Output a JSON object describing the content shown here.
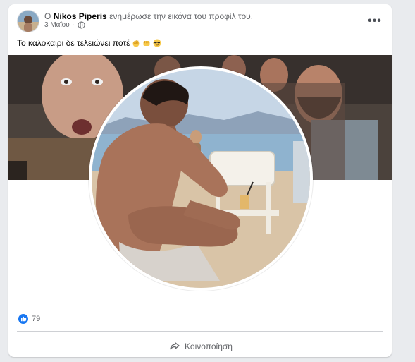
{
  "post": {
    "title_prefix": "Ο",
    "author": "Nikos Piperis",
    "title_suffix": "ενημέρωσε την εικόνα του προφίλ του.",
    "date": "3 Μαΐου",
    "date_separator": "·",
    "text": "Το καλοκαίρι δε τελειώνει ποτέ",
    "emojis": [
      "ok-hand-emoji",
      "fist-emoji",
      "sunglasses-emoji"
    ],
    "more_label": "•••"
  },
  "reactions": {
    "icon": "like-icon",
    "count": "79"
  },
  "actions": {
    "share_label": "Κοινοποίηση",
    "share_icon": "share-icon"
  },
  "colors": {
    "brand_blue": "#1877f2",
    "text_primary": "#050505",
    "text_secondary": "#65676b"
  }
}
